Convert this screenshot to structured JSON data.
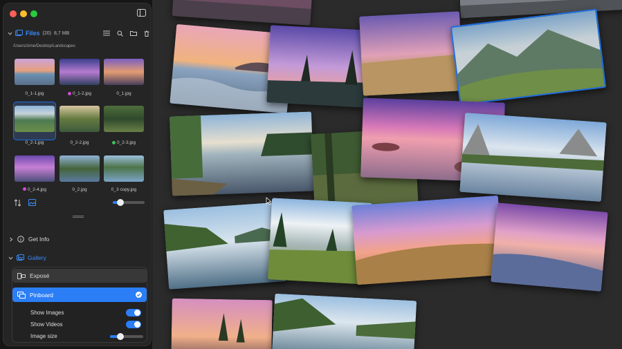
{
  "window": {
    "traffic_lights": [
      "#ff5f57",
      "#febc2e",
      "#28c840"
    ]
  },
  "files": {
    "title": "Files",
    "count": "(20)",
    "size": "8,7 MB",
    "path": "/Users/zirne/Desktop/Landscapes",
    "thumbs": [
      {
        "label": "0_1-1.jpg",
        "dot": ""
      },
      {
        "label": "0_1-2.jpg",
        "dot": "#d24ad8"
      },
      {
        "label": "0_1.jpg",
        "dot": ""
      },
      {
        "label": "0_2-1.jpg",
        "dot": ""
      },
      {
        "label": "0_2-2.jpg",
        "dot": ""
      },
      {
        "label": "0_2-3.jpg",
        "dot": "#3cc15a"
      },
      {
        "label": "0_2-4.jpg",
        "dot": "#d24ad8"
      },
      {
        "label": "0_2.jpg",
        "dot": ""
      },
      {
        "label": "0_3 copy.jpg",
        "dot": ""
      }
    ],
    "thumb_size_slider": 0.2
  },
  "sections": {
    "get_info": "Get Info",
    "gallery": "Gallery"
  },
  "gallery": {
    "expose": "Exposé",
    "pinboard": "Pinboard",
    "show_images": "Show Images",
    "show_videos": "Show Videos",
    "image_size": "Image size",
    "image_size_slider": 0.3
  },
  "colors": {
    "accent": "#2b7ef5",
    "selection": "#1e6fe0"
  }
}
